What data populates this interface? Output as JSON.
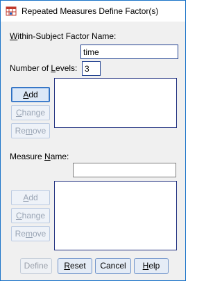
{
  "window": {
    "title": "Repeated Measures Define Factor(s)",
    "icon": "spss-grid-icon"
  },
  "factor": {
    "name_label_pre": "",
    "name_label_underline": "W",
    "name_label_post": "ithin-Subject Factor Name:",
    "name_value": "time",
    "levels_label_pre": "Number of ",
    "levels_label_underline": "L",
    "levels_label_post": "evels:",
    "levels_value": "3",
    "list_items": []
  },
  "factor_buttons": {
    "add": {
      "underline": "A",
      "rest": "dd",
      "enabled": true
    },
    "change": {
      "underline": "C",
      "rest": "hange",
      "enabled": false
    },
    "remove": {
      "pre": "Re",
      "underline": "m",
      "post": "ove",
      "enabled": false
    }
  },
  "measure": {
    "label_pre": "Measure ",
    "label_underline": "N",
    "label_post": "ame:",
    "value": "",
    "list_items": []
  },
  "measure_buttons": {
    "add": {
      "underline": "A",
      "rest": "dd",
      "enabled": false
    },
    "change": {
      "underline": "C",
      "rest": "hange",
      "enabled": false
    },
    "remove": {
      "pre": "Re",
      "underline": "m",
      "post": "ove",
      "enabled": false
    }
  },
  "footer": {
    "define": "Define",
    "reset_underline": "R",
    "reset_rest": "eset",
    "cancel": "Cancel",
    "help_underline": "H",
    "help_rest": "elp"
  },
  "colors": {
    "accent": "#1a73c8",
    "disabled_text": "#9aa5b5"
  }
}
